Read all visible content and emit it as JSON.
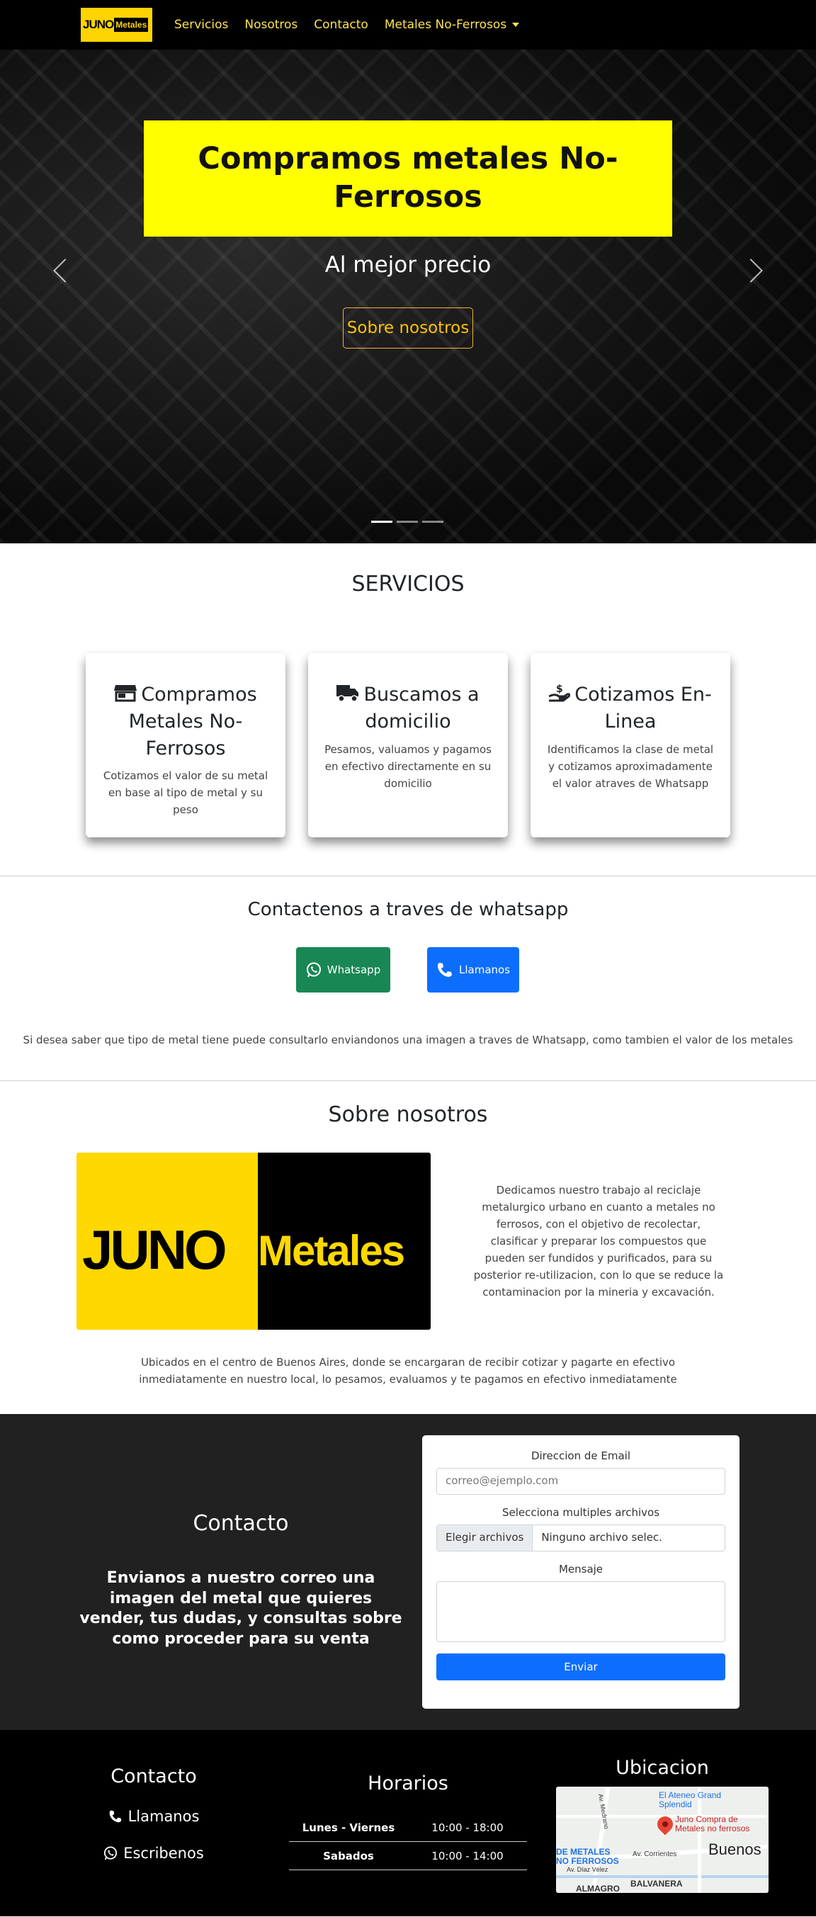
{
  "nav": {
    "brand_juno": "JUNO",
    "brand_metales": "Metales",
    "items": [
      "Servicios",
      "Nosotros",
      "Contacto",
      "Metales No-Ferrosos"
    ]
  },
  "hero": {
    "title": "Compramos metales No-Ferrosos",
    "subtitle": "Al mejor precio",
    "button": "Sobre nosotros",
    "slides": 3,
    "active_slide": 1
  },
  "servicios": {
    "title": "SERVICIOS",
    "cards": [
      {
        "icon": "store-icon",
        "title": "Compramos Metales No-Ferrosos",
        "text": "Cotizamos el valor de su metal en base al tipo de metal y su peso"
      },
      {
        "icon": "truck-icon",
        "title": "Buscamos a domicilio",
        "text": "Pesamos, valuamos y pagamos en efectivo directamente en su domicilio"
      },
      {
        "icon": "hand-money-icon",
        "title": "Cotizamos En-Linea",
        "text": "Identificamos la clase de metal y cotizamos aproximadamente el valor atraves de Whatsapp"
      }
    ]
  },
  "whatsapp": {
    "title": "Contactenos a traves de whatsapp",
    "whatsapp_button": "Whatsapp",
    "call_button": "Llamanos",
    "note": "Si desea saber que tipo de metal tiene puede consultarlo enviandonos una imagen a traves de Whatsapp, como tambien el valor de los metales"
  },
  "sobre": {
    "title": "Sobre nosotros",
    "logo_juno": "JUNO",
    "logo_metales": "Metales",
    "description": "Dedicamos nuestro trabajo al reciclaje metalurgico urbano en cuanto a metales no ferrosos, con el objetivo de recolectar, clasificar y preparar los compuestos que pueden ser fundidos y purificados, para su posterior re-utilizacion, con lo que se reduce la contaminacion por la mineria y excavación.",
    "location": "Ubicados en el centro de Buenos Aires, donde se encargaran de recibir cotizar y pagarte en efectivo inmediatamente en nuestro local, lo pesamos, evaluamos y te pagamos en efectivo inmediatamente"
  },
  "contacto_form": {
    "title": "Contacto",
    "text": "Envianos a nuestro correo una imagen del metal que quieres vender, tus dudas, y consultas sobre como proceder para su venta",
    "email_label": "Direccion de Email",
    "email_placeholder": "correo@ejemplo.com",
    "files_label": "Selecciona multiples archivos",
    "files_button": "Elegir archivos",
    "files_none": "Ninguno archivo selec.",
    "message_label": "Mensaje",
    "submit": "Enviar"
  },
  "footer": {
    "contact_title": "Contacto",
    "call_link": "Llamanos",
    "write_link": "Escribenos",
    "hours_title": "Horarios",
    "hours": [
      {
        "day": "Lunes - Viernes",
        "time": "10:00 - 18:00"
      },
      {
        "day": "Sabados",
        "time": "10:00 - 14:00"
      }
    ],
    "map_title": "Ubicacion",
    "map_labels": {
      "ateneo": "El Ateneo Grand Splendid",
      "juno": "Juno Compra de Metales no ferrosos",
      "de_metales": "DE METALES NO FERROSOS",
      "corrientes": "Av. Corrientes",
      "buenos": "Buenos",
      "balvanera": "BALVANERA",
      "almagro": "ALMAGRO",
      "medrano": "Av. Medrano",
      "diaz_velez": "Av. Díaz Vélez"
    }
  },
  "colors": {
    "brand_yellow": "#ffd400",
    "hero_box": "#ffff00",
    "whatsapp_green": "#198754",
    "primary_blue": "#0d6efd",
    "dark_section": "#212121"
  }
}
